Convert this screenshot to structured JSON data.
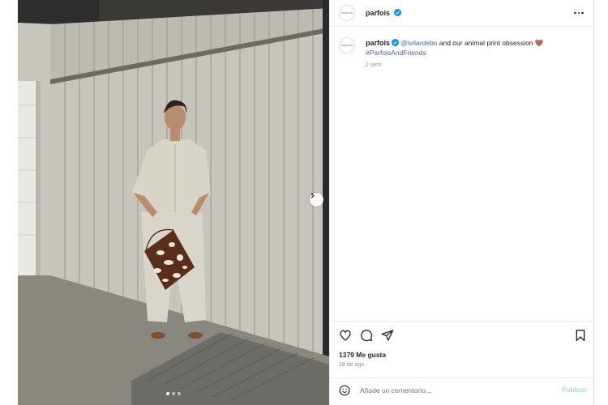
{
  "post": {
    "account": {
      "username": "parfois",
      "avatar_text": "PARFOIS",
      "verified": true,
      "verified_color": "#0095f6"
    },
    "caption": {
      "mention": "@ivilardebo",
      "text": " and our animal print obsession 🤎",
      "hashtag": "#ParfoisAndFriends",
      "time_ago": "2 sem"
    },
    "actions": {
      "like_icon": "heart-icon",
      "comment_icon": "comment-icon",
      "share_icon": "paper-plane-icon",
      "save_icon": "bookmark-icon"
    },
    "likes_text": "1379 Me gusta",
    "date_text": "18 de ago.",
    "comment_box": {
      "placeholder": "Añade un comentario...",
      "publish_label": "Publicar",
      "emoji_icon": "smiley-icon"
    },
    "carousel": {
      "slide_count": 3,
      "active_slide": 1,
      "next_icon": "chevron-right-icon"
    },
    "colors": {
      "link": "#4a5fc1",
      "publish_disabled": "#8ec6f5",
      "secondary_text": "#8e8e8e"
    }
  }
}
